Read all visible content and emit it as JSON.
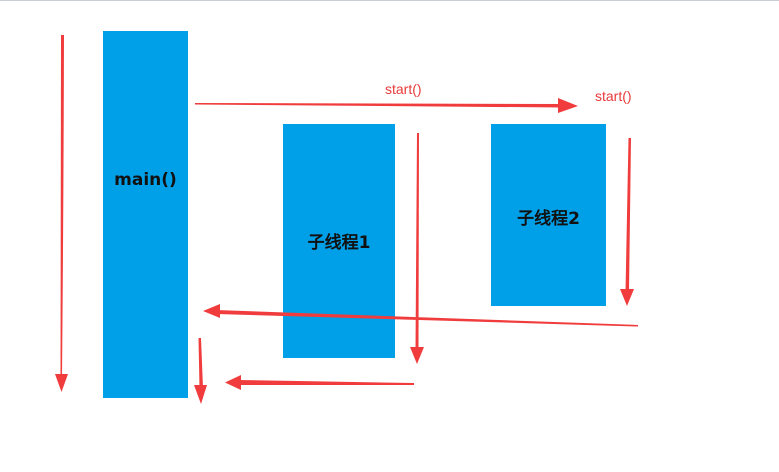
{
  "diagram": {
    "blocks": {
      "main": {
        "label": "main()"
      },
      "thread1": {
        "label": "子线程1"
      },
      "thread2": {
        "label": "子线程2"
      }
    },
    "calls": {
      "start_thread1": {
        "label": "start()"
      },
      "start_thread2": {
        "label": "start()"
      }
    }
  },
  "colors": {
    "block_fill": "#00a0e9",
    "arrow": "#f03c3c",
    "label_text": "#e83a3a",
    "block_text": "#111111"
  }
}
